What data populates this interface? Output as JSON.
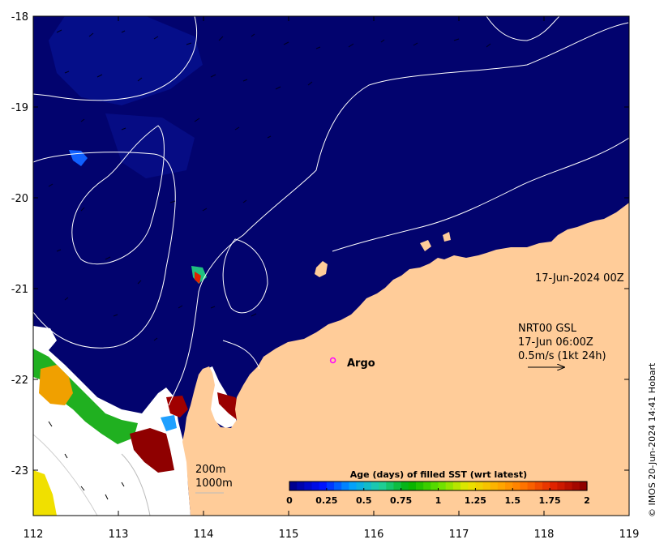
{
  "map": {
    "x_ticks": [
      "112",
      "113",
      "114",
      "115",
      "116",
      "117",
      "118",
      "119"
    ],
    "y_ticks": [
      "-18",
      "-19",
      "-20",
      "-21",
      "-22",
      "-23"
    ],
    "lon_range": [
      112,
      119
    ],
    "lat_range": [
      -23.5,
      -18
    ],
    "colors": {
      "ocean": "#02036e",
      "land": "#ffcc99",
      "missing": "#ffffff",
      "contour": "#ffffff",
      "frame": "#000000"
    }
  },
  "annotations": {
    "date_label": "17-Jun-2024 00Z",
    "current_source": "NRT00 GSL",
    "current_time": "17-Jun 06:00Z",
    "current_scale": "0.5m/s (1kt 24h)",
    "argo_label": "Argo",
    "contour_200": "200m",
    "contour_1000": "1000m",
    "copyright": "© IMOS 20-Jun-2024 14:41 Hobart"
  },
  "colorbar": {
    "title": "Age (days) of filled SST (wrt latest)",
    "tick_labels": [
      "0",
      "0.25",
      "0.5",
      "0.75",
      "1",
      "1.25",
      "1.5",
      "1.75",
      "2"
    ],
    "colors": [
      "#00008f",
      "#0010ff",
      "#00a0ff",
      "#20d0a0",
      "#00b000",
      "#60e000",
      "#e8e800",
      "#ffb000",
      "#ff7000",
      "#e02000",
      "#8f0000"
    ]
  },
  "argo_float": {
    "lon": 115.52,
    "lat": -21.79,
    "color": "#ff00ff"
  }
}
